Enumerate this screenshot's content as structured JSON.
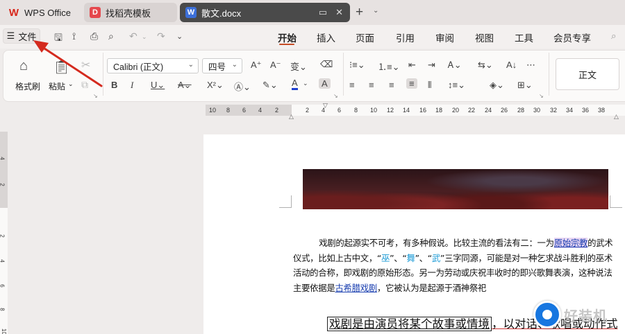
{
  "tabs": [
    {
      "label": "WPS Office",
      "icon": "wps-logo-icon"
    },
    {
      "label": "找稻壳模板",
      "icon": "docer-icon"
    },
    {
      "label": "散文.docx",
      "icon": "word-doc-icon"
    }
  ],
  "menubar": {
    "file_label": "文件",
    "items": [
      "开始",
      "插入",
      "页面",
      "引用",
      "审阅",
      "视图",
      "工具",
      "会员专享"
    ],
    "active": "开始"
  },
  "ribbon": {
    "format_painter_label": "格式刷",
    "paste_label": "粘贴",
    "font_name": "Calibri (正文)",
    "font_size": "四号",
    "style_label": "正文"
  },
  "ruler": {
    "ticks": [
      "10",
      "8",
      "6",
      "4",
      "2",
      "2",
      "4",
      "6",
      "8",
      "10",
      "12",
      "14",
      "16",
      "18",
      "20",
      "22",
      "24",
      "26",
      "28",
      "30",
      "32",
      "34",
      "36",
      "38"
    ],
    "vticks": [
      "4",
      "2",
      "2",
      "4",
      "6",
      "8",
      "10"
    ]
  },
  "document": {
    "para1_parts": [
      {
        "text": "戏剧的起源实不可考，有多种假说。比较主流的看法有二：一为",
        "style": "normal"
      },
      {
        "text": "原始宗教",
        "style": "link-hl"
      },
      {
        "text": "的武术仪式，比如上古中文，“",
        "style": "normal"
      },
      {
        "text": "巫",
        "style": "q-blue"
      },
      {
        "text": "”、“",
        "style": "normal"
      },
      {
        "text": "舞",
        "style": "q-blue"
      },
      {
        "text": "”、“",
        "style": "normal"
      },
      {
        "text": "武",
        "style": "q-blue"
      },
      {
        "text": "”三字同源，可能是对一种乞求战斗胜利的巫术活动的合称，即戏剧的原始形态。另一为劳动或庆祝丰收时的即兴歌舞表演，这种说法主要依据是",
        "style": "normal"
      },
      {
        "text": "古希腊戏剧",
        "style": "link-blue"
      },
      {
        "text": "，它被认为是起源于酒神祭祀",
        "style": "normal"
      }
    ],
    "para2_boxed": "戏剧是由演员将某个故事或情境",
    "para2_rest": "，以对话、歌唱或动作式"
  },
  "watermark": {
    "text": "好装机"
  }
}
